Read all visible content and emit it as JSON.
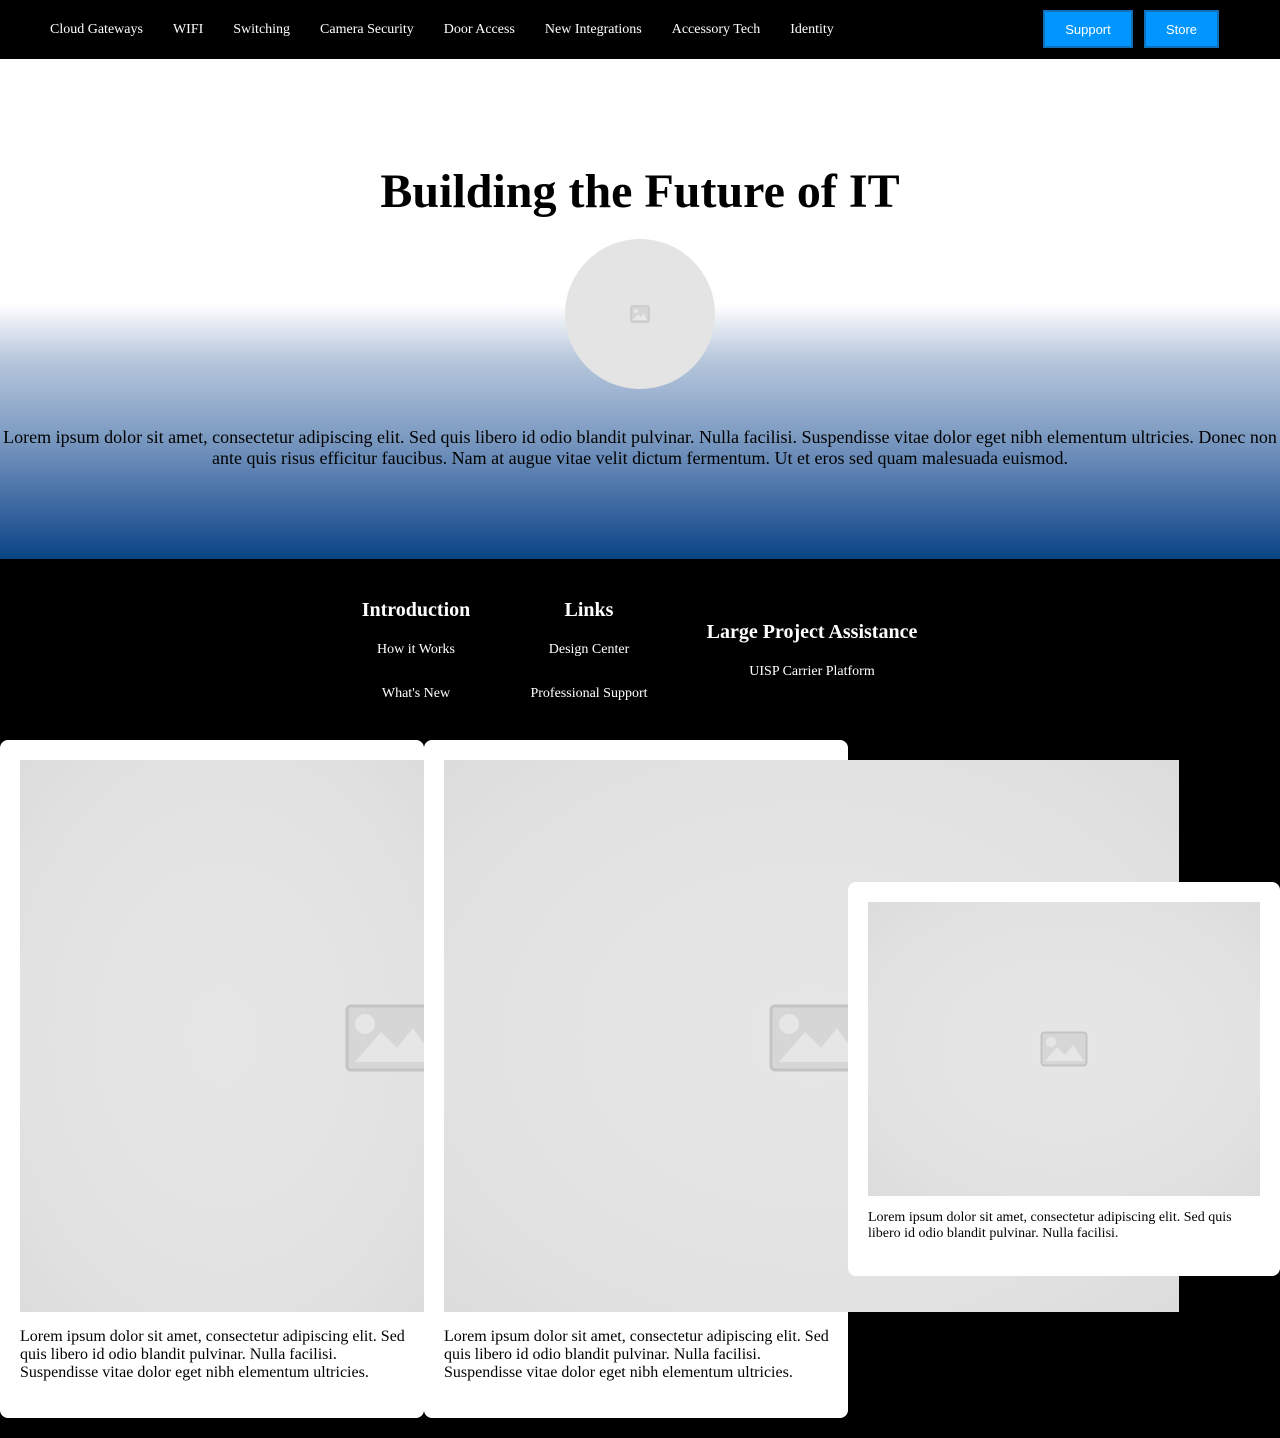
{
  "nav": {
    "items": [
      {
        "label": "Cloud Gateways"
      },
      {
        "label": "WIFI"
      },
      {
        "label": "Switching"
      },
      {
        "label": "Camera Security"
      },
      {
        "label": "Door Access"
      },
      {
        "label": "New Integrations"
      },
      {
        "label": "Accessory Tech"
      },
      {
        "label": "Identity"
      }
    ],
    "support_label": "Support",
    "store_label": "Store",
    "button_color": "#0095ff"
  },
  "hero": {
    "title": "Building the Future of IT",
    "avatar_icon": "image-placeholder-icon",
    "text": "Lorem ipsum dolor sit amet, consectetur adipiscing elit. Sed quis libero id odio blandit pulvinar. Nulla facilisi. Suspendisse vitae dolor eget nibh elementum ultricies. Donec non ante quis risus efficitur faucibus. Nam at augue vitae velit dictum fermentum. Ut et eros sed quam malesuada euismod.",
    "gradient_bottom_color": "#0a4485"
  },
  "footer": {
    "introduction": {
      "heading": "Introduction",
      "links": [
        "How it Works",
        "What's New"
      ]
    },
    "links": {
      "heading": "Links",
      "links": [
        "Design Center",
        "Professional Support"
      ]
    },
    "large_project": {
      "heading": "Large Project Assistance",
      "links": [
        "UISP Carrier Platform"
      ]
    }
  },
  "cards": [
    {
      "image_icon": "image-placeholder-icon",
      "text": "Lorem ipsum dolor sit amet, consectetur adipiscing elit. Sed quis libero id odio blandit pulvinar. Nulla facilisi. Suspendisse vitae dolor eget nibh elementum ultricies."
    },
    {
      "image_icon": "image-placeholder-icon",
      "text": "Lorem ipsum dolor sit amet, consectetur adipiscing elit. Sed quis libero id odio blandit pulvinar. Nulla facilisi. Suspendisse vitae dolor eget nibh elementum ultricies."
    },
    {
      "image_icon": "image-placeholder-icon",
      "text": "Lorem ipsum dolor sit amet, consectetur adipiscing elit. Sed quis libero id odio blandit pulvinar. Nulla facilisi."
    }
  ]
}
